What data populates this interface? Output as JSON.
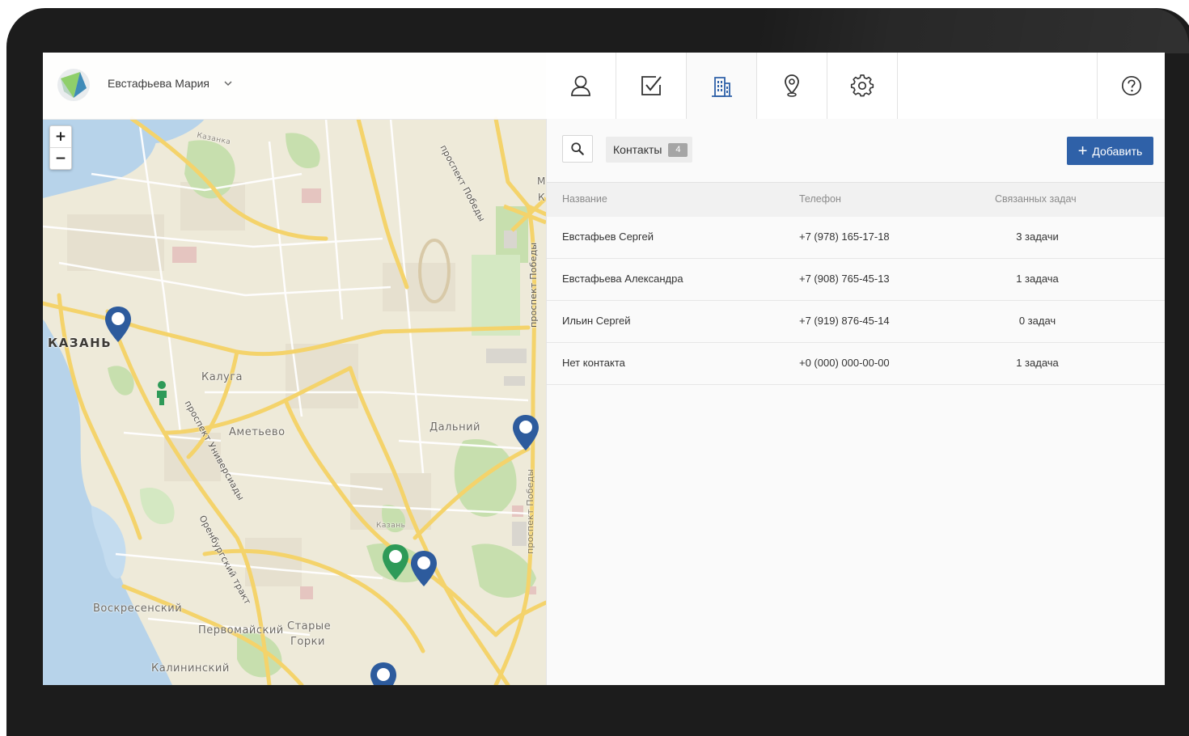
{
  "app": {
    "user_name": "Евстафьева Мария"
  },
  "tabs": [
    {
      "icon": "user-icon",
      "active": false
    },
    {
      "icon": "checkbox-icon",
      "active": false
    },
    {
      "icon": "building-icon",
      "active": true
    },
    {
      "icon": "location-pin-icon",
      "active": false
    },
    {
      "icon": "gear-icon",
      "active": false
    },
    {
      "icon": "help-icon",
      "active": false
    }
  ],
  "toolbar": {
    "contacts_label": "Контакты",
    "contacts_count": "4",
    "add_label": "Добавить"
  },
  "table": {
    "headers": {
      "name": "Название",
      "phone": "Телефон",
      "tasks": "Связанных задач"
    },
    "rows": [
      {
        "name": "Евстафьев Сергей",
        "phone": "+7 (978) 165-17-18",
        "tasks": "3 задачи"
      },
      {
        "name": "Евстафьева Александра",
        "phone": "+7 (908) 765-45-13",
        "tasks": "1 задача"
      },
      {
        "name": "Ильин Сергей",
        "phone": "+7 (919) 876-45-14",
        "tasks": "0 задач"
      },
      {
        "name": "Нет контакта",
        "phone": "+0 (000) 000-00-00",
        "tasks": "1 задача"
      }
    ]
  },
  "map": {
    "zoom_in": "+",
    "zoom_out": "−",
    "labels": {
      "kazan": "КАЗАНЬ",
      "kaluga": "Калуга",
      "ametevo": "Аметьево",
      "dalniy": "Дальний",
      "voskresenskiy": "Воскресенский",
      "pervomayskiy": "Первомайский",
      "starye": "Старые",
      "gorki": "Горки",
      "kalininskiy": "Калининский",
      "pr_pobedy_top": "проспект Победы",
      "pr_pobedy_right": "проспект Победы",
      "pr_universiady": "проспект Универсиады",
      "orenburg": "Оренбургский тракт",
      "kazan_small": "Казань",
      "kazanka": "Казанка",
      "m": "М",
      "k": "К",
      "pr_pobedy_lower": "проспект Победы"
    },
    "pin_colors": {
      "blue": "#2d5b9d",
      "green": "#2e9a58"
    }
  }
}
